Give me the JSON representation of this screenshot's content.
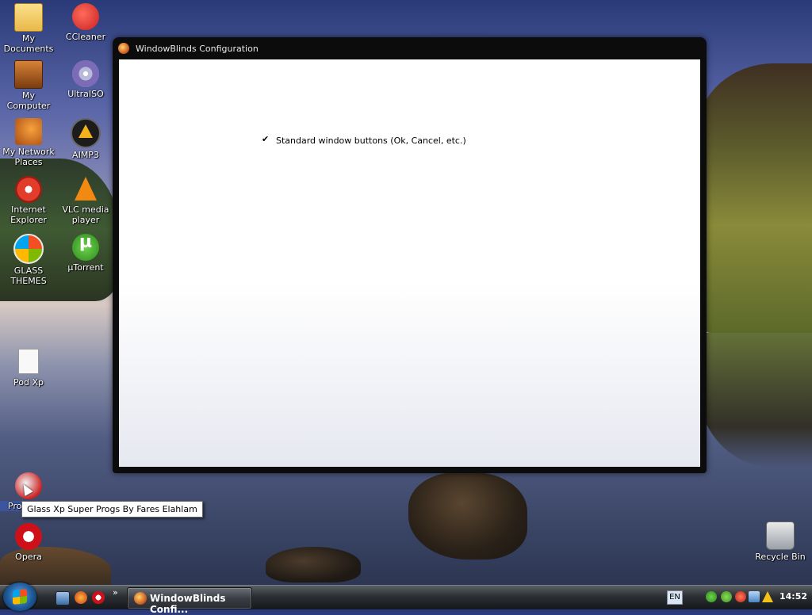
{
  "desktop": {
    "icons": [
      {
        "label": "My\nDocuments",
        "icon": "folder-icon"
      },
      {
        "label": "CCleaner",
        "icon": "ccleaner-icon"
      },
      {
        "label": "My Computer",
        "icon": "computer-icon"
      },
      {
        "label": "UltraISO",
        "icon": "disc-icon"
      },
      {
        "label": "My Network\nPlaces",
        "icon": "network-icon"
      },
      {
        "label": "AIMP3",
        "icon": "aimp-icon"
      },
      {
        "label": "Internet\nExplorer",
        "icon": "ie-icon"
      },
      {
        "label": "VLC media\nplayer",
        "icon": "vlc-icon"
      },
      {
        "label": "GLASS\nTHEMES",
        "icon": "windows-logo-icon"
      },
      {
        "label": "µTorrent",
        "icon": "utorrent-icon"
      },
      {
        "label": "Pod Xp",
        "icon": "file-icon"
      },
      {
        "label": "Programs",
        "icon": "programs-icon"
      },
      {
        "label": "Opera",
        "icon": "opera-icon"
      },
      {
        "label": "Recycle Bin",
        "icon": "recycle-bin-icon"
      }
    ],
    "tooltip": "Glass Xp Super Progs By Fares Elahlam"
  },
  "window": {
    "title": "WindowBlinds Configuration",
    "checkbox": {
      "label": "Standard window buttons (Ok, Cancel, etc.)",
      "checked": true
    }
  },
  "taskbar": {
    "quick_launch_more": "»",
    "task_label": "WindowBlinds Confi...",
    "language": "EN",
    "clock": "14:52"
  }
}
